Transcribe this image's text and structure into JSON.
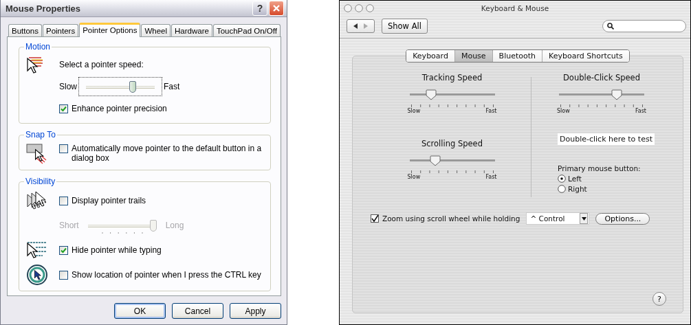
{
  "mouse_properties": {
    "title": "Mouse Properties",
    "title_buttons": {
      "help": "?"
    },
    "tabs": [
      {
        "label": "Buttons",
        "selected": false
      },
      {
        "label": "Pointers",
        "selected": false
      },
      {
        "label": "Pointer Options",
        "selected": true
      },
      {
        "label": "Wheel",
        "selected": false
      },
      {
        "label": "Hardware",
        "selected": false
      },
      {
        "label": "TouchPad On/Off",
        "selected": false
      }
    ],
    "groups": [
      {
        "legend": "Motion",
        "items": [
          {
            "kind": "label",
            "text": "Select a pointer speed:"
          },
          {
            "kind": "slider",
            "min_label": "Slow",
            "max_label": "Fast",
            "level": 0.7,
            "disabled": false,
            "focused": true,
            "ticks": false
          },
          {
            "kind": "checkbox",
            "label": "Enhance pointer precision",
            "checked": true
          }
        ]
      },
      {
        "legend": "Snap To",
        "items": [
          {
            "kind": "checkbox",
            "label": "Automatically move pointer to the default button in a dialog box",
            "checked": false
          }
        ]
      },
      {
        "legend": "Visibility",
        "items": [
          {
            "kind": "checkbox",
            "label": "Display pointer trails",
            "checked": false
          },
          {
            "kind": "slider",
            "min_label": "Short",
            "max_label": "Long",
            "level": 1.0,
            "disabled": true,
            "focused": false,
            "ticks": true
          },
          {
            "kind": "checkbox",
            "label": "Hide pointer while typing",
            "checked": true
          },
          {
            "kind": "checkbox",
            "label": "Show location of pointer when I press the CTRL key",
            "checked": false
          }
        ]
      }
    ],
    "buttons": [
      {
        "label": "OK",
        "default": true
      },
      {
        "label": "Cancel",
        "default": false
      },
      {
        "label": "Apply",
        "default": false
      }
    ]
  },
  "keyboard_mouse": {
    "title": "Keyboard & Mouse",
    "show_all": "Show All",
    "tabs": [
      {
        "label": "Keyboard",
        "selected": false
      },
      {
        "label": "Mouse",
        "selected": true
      },
      {
        "label": "Bluetooth",
        "selected": false
      },
      {
        "label": "Keyboard Shortcuts",
        "selected": false
      }
    ],
    "left_sliders": [
      {
        "title": "Tracking Speed",
        "min_label": "Slow",
        "max_label": "Fast",
        "level": 0.25
      },
      {
        "title": "Scrolling Speed",
        "min_label": "Slow",
        "max_label": "Fast",
        "level": 0.3
      }
    ],
    "right_slider": {
      "title": "Double-Click Speed",
      "min_label": "Slow",
      "max_label": "Fast",
      "level": 0.68
    },
    "test_area": "Double-click here to test",
    "primary_button": {
      "label": "Primary mouse button:",
      "options": [
        {
          "label": "Left",
          "selected": true
        },
        {
          "label": "Right",
          "selected": false
        }
      ]
    },
    "zoom": {
      "label": "Zoom using scroll wheel while holding",
      "checked": true,
      "modifier": "^ Control",
      "options_button": "Options..."
    },
    "help": "?"
  }
}
